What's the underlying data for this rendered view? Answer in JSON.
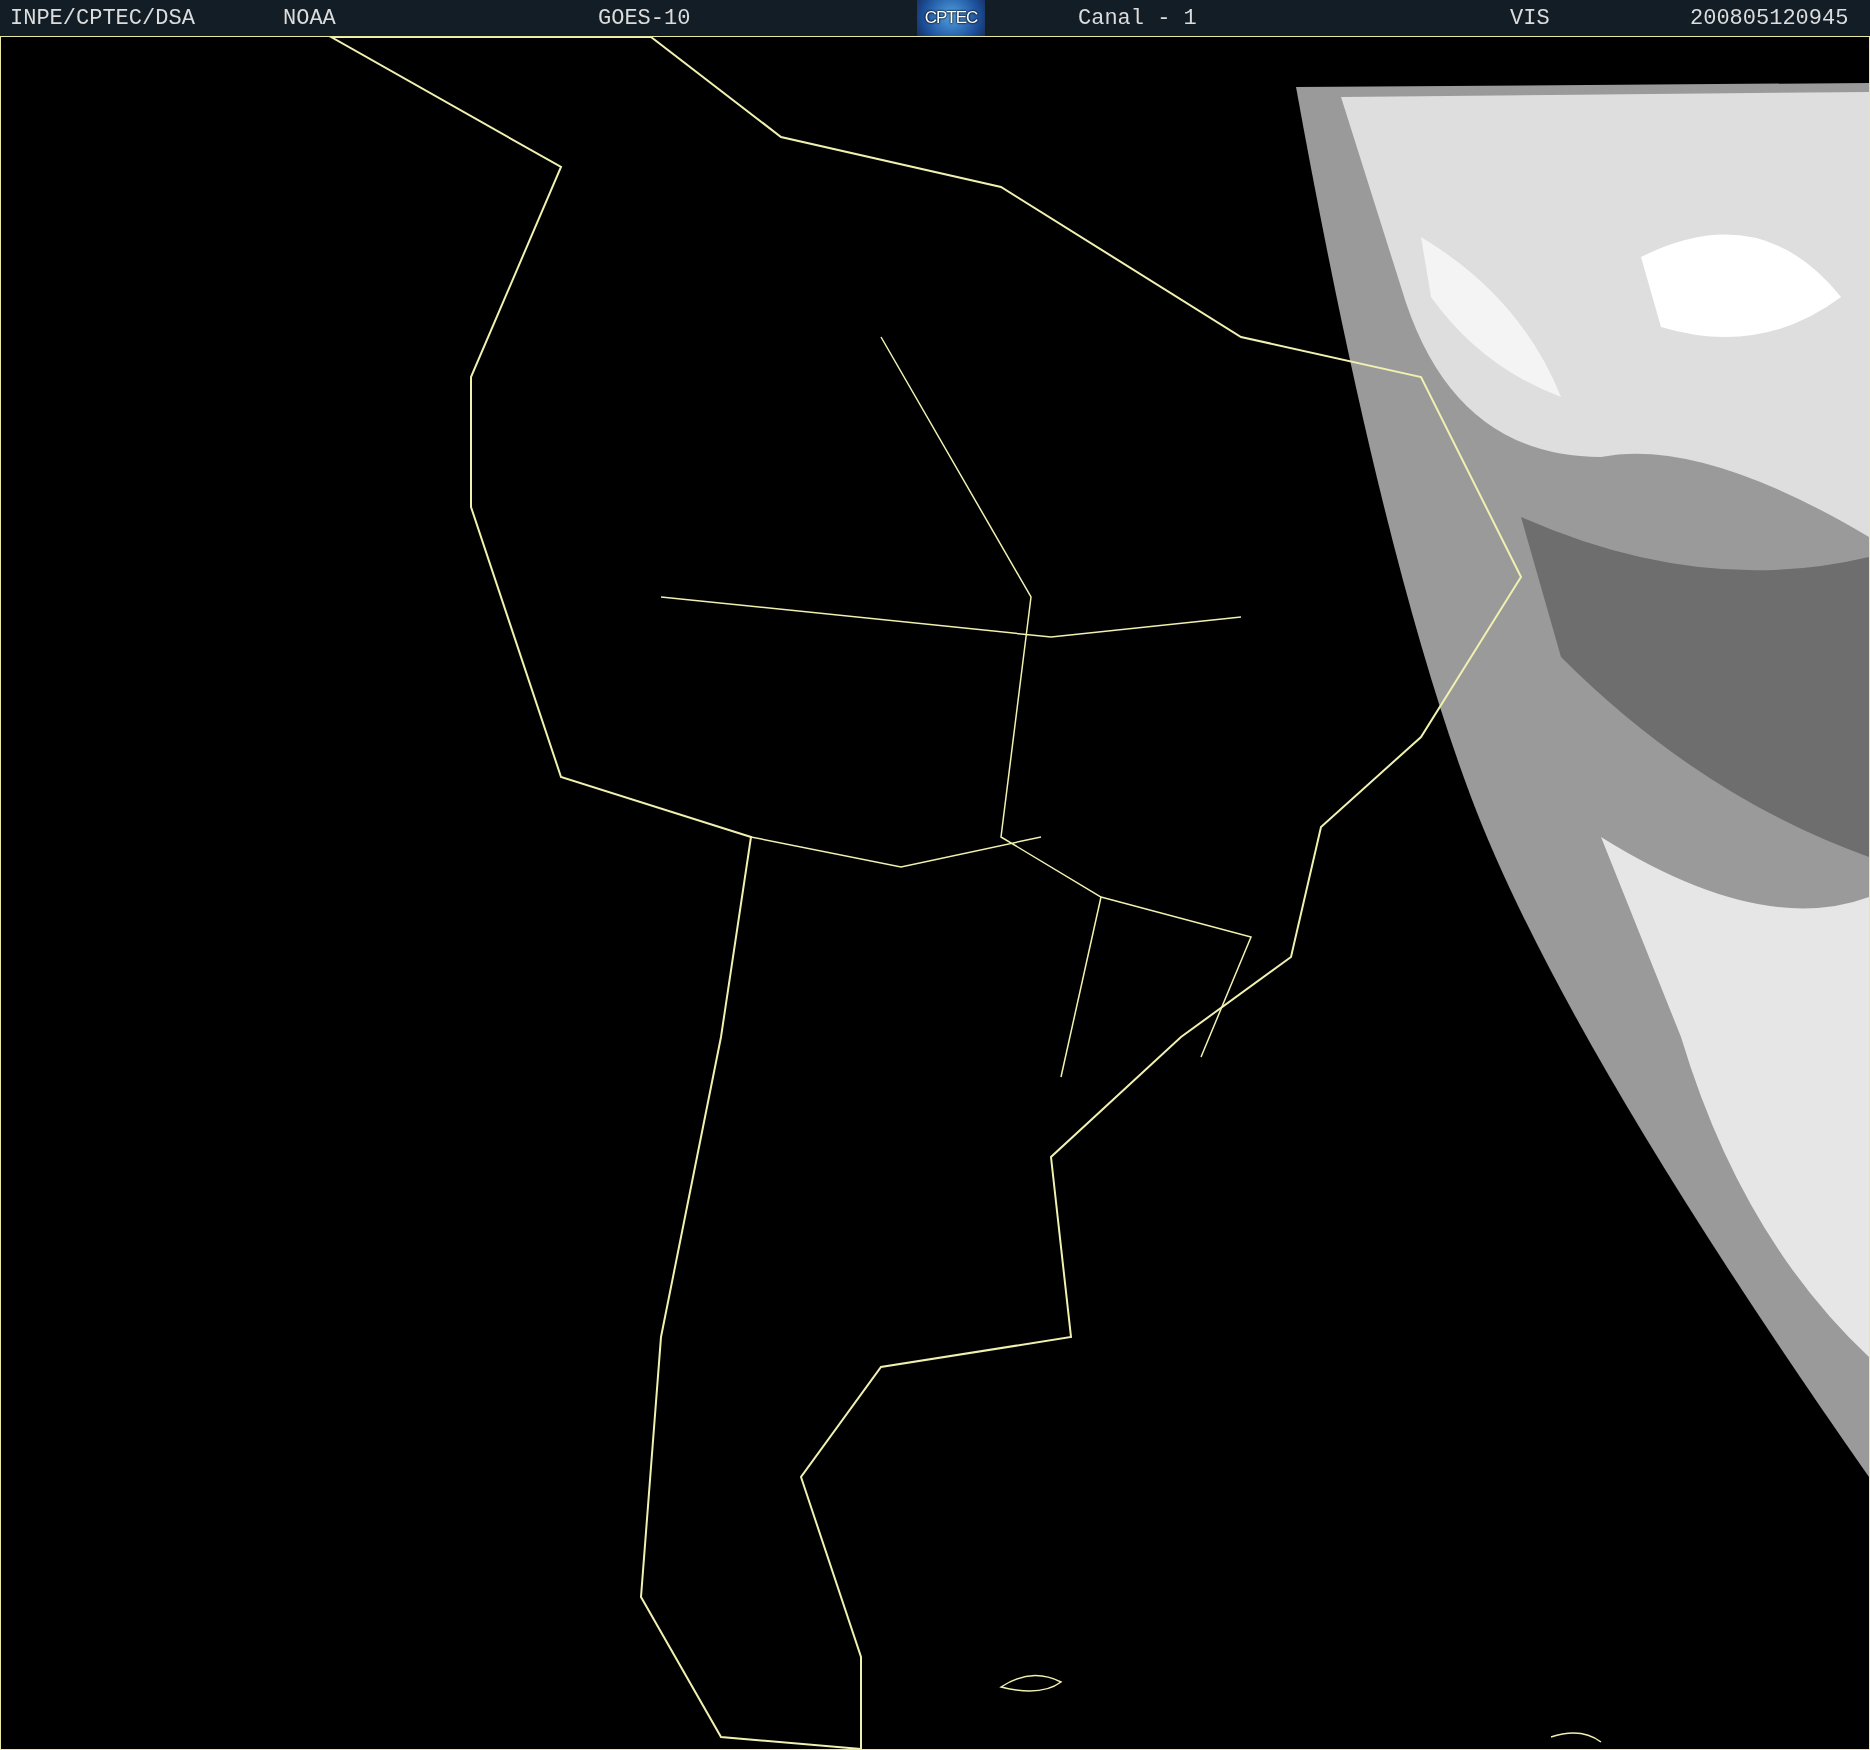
{
  "header": {
    "items": [
      {
        "kind": "text",
        "text": "INPE/CPTEC/DSA"
      },
      {
        "kind": "text",
        "text": "NOAA"
      },
      {
        "kind": "text",
        "text": "GOES-10"
      },
      {
        "kind": "logo",
        "text": "CPTEC"
      },
      {
        "kind": "text",
        "text": "Canal - 1"
      },
      {
        "kind": "text",
        "text": "VIS"
      },
      {
        "kind": "text",
        "text": "200805120945"
      }
    ]
  }
}
